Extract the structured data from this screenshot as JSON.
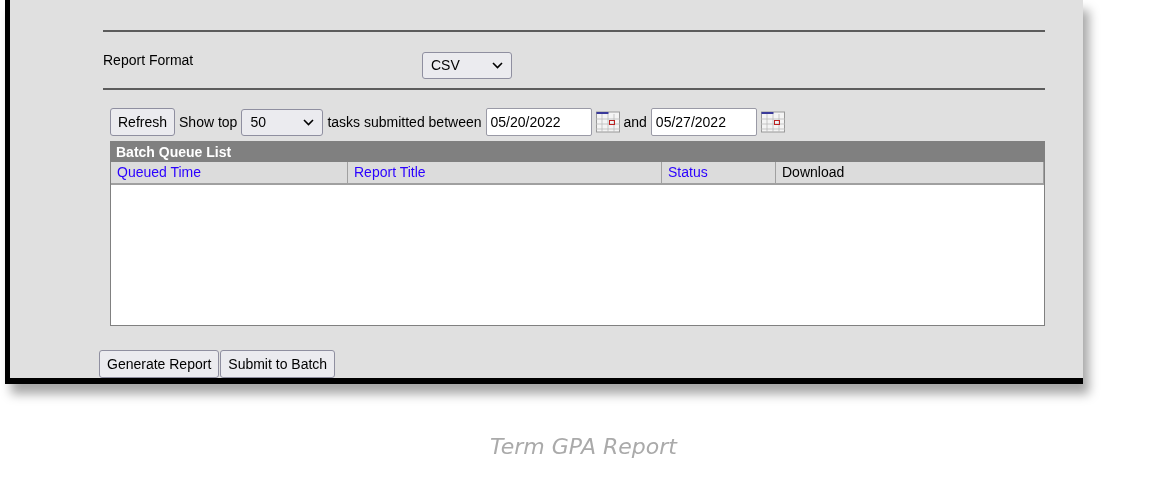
{
  "report_format": {
    "label": "Report Format",
    "value": "CSV"
  },
  "toolbar": {
    "refresh": "Refresh",
    "show_top_label": "Show top",
    "show_top_value": "50",
    "between_label": "tasks submitted between",
    "start_date": "05/20/2022",
    "and_label": "and",
    "end_date": "05/27/2022"
  },
  "batch_queue": {
    "title": "Batch Queue List",
    "columns": [
      {
        "label": "Queued Time",
        "sortable": true
      },
      {
        "label": "Report Title",
        "sortable": true
      },
      {
        "label": "Status",
        "sortable": true
      },
      {
        "label": "Download",
        "sortable": false
      }
    ]
  },
  "buttons": [
    "Generate Report",
    "Submit to Batch"
  ],
  "caption": "Term GPA Report"
}
